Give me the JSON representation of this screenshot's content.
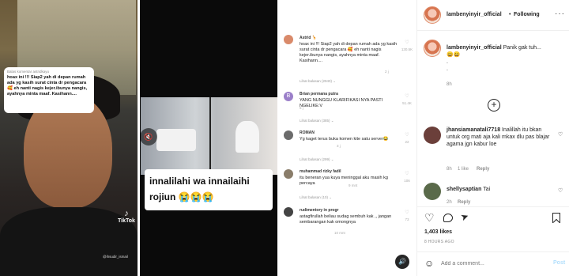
{
  "panel1": {
    "bubble_header": "Balas komentar astridkayu",
    "bubble_text": "hoax ini !!! Siap2 yah di depan rumah ada yg kasih surat cinta dr pengacara 🥰 eh nanti nagis kejer.ibunya nangis, ayahnya minta maaf. Kasihann....",
    "tiktok_label": "TikTok",
    "tiktok_handle": "@ihsudir_ismail"
  },
  "panel2": {
    "caption_line1": "innalilahi wa innailaihi",
    "caption_line2": "rojiun 😭😭😭",
    "volume_icon": "speaker-icon"
  },
  "comments": [
    {
      "name": "Astrid 🦒",
      "text": "hoax ini !!! Siap2 yah di depan rumah ada yg kasih surat cinta dr pengacara 🥰 eh nanti nagis kejer.ibunya nangis, ayahnya minta maaf. Kasihann....",
      "time": "2 j",
      "likes": "130.5K",
      "replies": "Lihat balasan (2940) ⌄",
      "avatar_color": "#d98a6a"
    },
    {
      "name": "Brian permana putra",
      "text": "YANG NUNGGU KLARIFIKASI NYA PASTI NGELIKE:V",
      "time": "5 j",
      "likes": "51.4K",
      "replies": "Lihat balasan (385) ⌄",
      "avatar_color": "#9b7fc9",
      "avatar_letter": "B"
    },
    {
      "name": "ROMAN",
      "text": "Yg kaget terus buka komen kite satu server😂",
      "time": "3 j",
      "likes": "22",
      "replies": "Lihat balasan (299) ⌄",
      "avatar_color": "#6b6b6b"
    },
    {
      "name": "muhammad rizky fadil",
      "text": "itu beneran yua kuya meninggal aku masih kg percaya",
      "time": "9 mnt",
      "likes": "106",
      "replies": "Lihat balasan (10) ⌄",
      "avatar_color": "#8a7d6a"
    },
    {
      "name": "rudimentory in progr",
      "text": "astagfirullah beliau sudag sembuh kak ,, jangan sembarangan kak omongnya",
      "time": "10 mnt",
      "likes": "73",
      "replies": "",
      "avatar_color": "#444444"
    }
  ],
  "mute_icon": "volume-icon",
  "post": {
    "header_username": "lambenyinyir_official",
    "follow_label": "Following",
    "caption_username": "lambenyinyir_official",
    "caption_text": "Panik gak tuh...",
    "caption_emoji": "😄😄",
    "caption_dots": ".\n.",
    "caption_time": "8h",
    "replies": [
      {
        "username": "jhansiamanatali7718",
        "text": "Inalillah itu bkan untuk org mati aja kali mkax dlu pas blajar agama jgn kabur loe",
        "time": "8h",
        "likes": "1 like",
        "reply": "Reply",
        "avatar_color": "#6b3f3a"
      },
      {
        "username": "shellysaptian",
        "text": "Tai",
        "time": "2h",
        "reply": "Reply",
        "avatar_color": "#5a6a4a"
      }
    ],
    "likes_count": "1,403 likes",
    "posted_ago": "8 HOURS AGO",
    "add_comment_placeholder": "Add a comment...",
    "post_button": "Post"
  }
}
